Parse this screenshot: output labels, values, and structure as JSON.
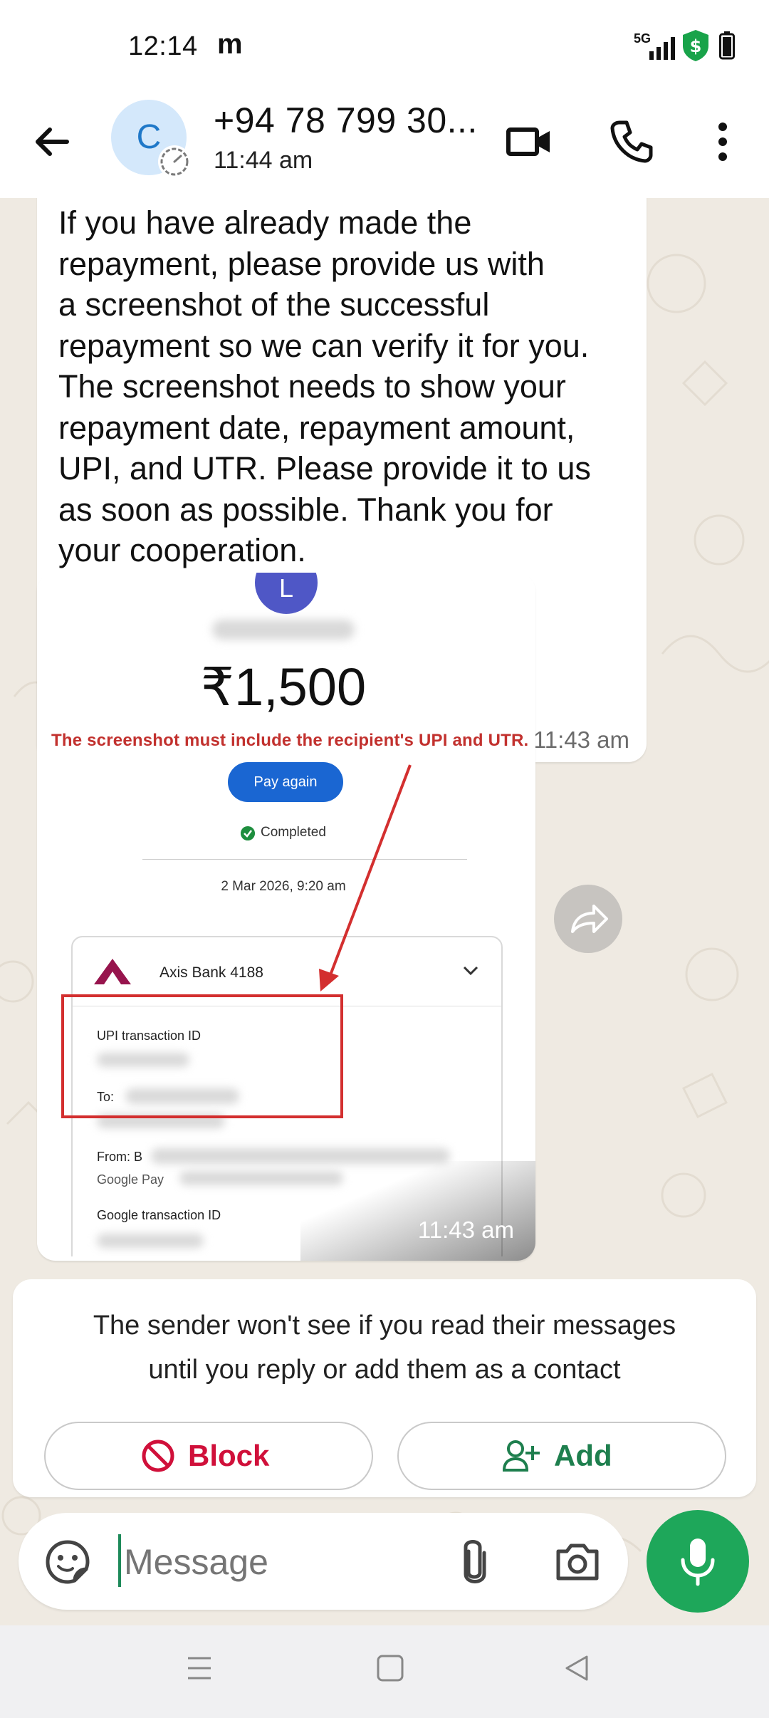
{
  "status_bar": {
    "time": "12:14",
    "carrier_icon": "m",
    "network": "5G",
    "icons": [
      "signal-icon",
      "shield-dollar-icon",
      "battery-icon"
    ]
  },
  "header": {
    "avatar_initial": "C",
    "contact_name": "+94 78 799 30...",
    "last_seen": "11:44 am",
    "icons": [
      "back-arrow-icon",
      "video-call-icon",
      "phone-call-icon",
      "more-vert-icon"
    ]
  },
  "messages": [
    {
      "type": "text",
      "text": "If you have already made the\nrepayment, please provide us with\na screenshot of the successful\nrepayment so we can verify it for you.\nThe screenshot needs to show your\nrepayment date, repayment amount,\nUPI, and UTR. Please provide it to us\nas soon as possible. Thank you for\nyour cooperation.",
      "time": "11:43 am"
    },
    {
      "type": "image",
      "time": "11:43 am",
      "screenshot": {
        "avatar_initial": "L",
        "amount": "₹1,500",
        "warning": "The screenshot must include the recipient's UPI and UTR.",
        "pay_again": "Pay again",
        "status": "Completed",
        "datetime": "2 Mar 2026, 9:20 am",
        "bank": "Axis Bank 4188",
        "upi_label": "UPI transaction ID",
        "to_label": "To:",
        "from_label": "From: B",
        "from_sub": "Google Pay",
        "google_txn_label": "Google transaction ID"
      }
    }
  ],
  "info_card": {
    "text": "The sender won't see if you read their messages\nuntil you reply or add them as a contact",
    "block_label": "Block",
    "add_label": "Add"
  },
  "input": {
    "placeholder": "Message"
  },
  "colors": {
    "accent_green": "#1ea75a",
    "block_red": "#d0103a",
    "add_green": "#1e7f4e",
    "chat_bg": "#efeae2"
  }
}
